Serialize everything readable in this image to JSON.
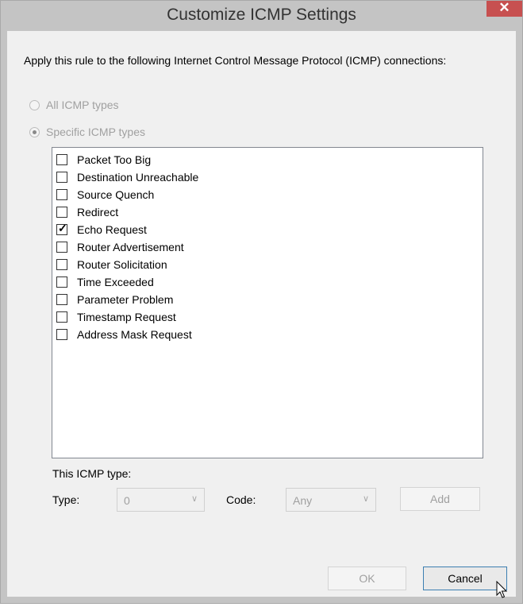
{
  "window": {
    "title": "Customize ICMP Settings",
    "close_glyph": "✕"
  },
  "intro_text": "Apply this rule to the following Internet Control Message Protocol (ICMP) connections:",
  "radios": [
    {
      "label": "All ICMP types",
      "selected": false
    },
    {
      "label": "Specific ICMP types",
      "selected": true
    }
  ],
  "icmp_types": [
    {
      "label": "Packet Too Big",
      "checked": false
    },
    {
      "label": "Destination Unreachable",
      "checked": false
    },
    {
      "label": "Source Quench",
      "checked": false
    },
    {
      "label": "Redirect",
      "checked": false
    },
    {
      "label": "Echo Request",
      "checked": true
    },
    {
      "label": "Router Advertisement",
      "checked": false
    },
    {
      "label": "Router Solicitation",
      "checked": false
    },
    {
      "label": "Time Exceeded",
      "checked": false
    },
    {
      "label": "Parameter Problem",
      "checked": false
    },
    {
      "label": "Timestamp Request",
      "checked": false
    },
    {
      "label": "Address Mask Request",
      "checked": false
    }
  ],
  "this_type": {
    "label": "This ICMP type:",
    "type_label": "Type:",
    "type_value": "0",
    "code_label": "Code:",
    "code_value": "Any",
    "add_label": "Add"
  },
  "buttons": {
    "ok": "OK",
    "cancel": "Cancel"
  },
  "icons": {
    "close": "close-icon",
    "chevron": "chevron-down-icon",
    "checkmark": "checkmark-icon",
    "cursor": "mouse-pointer-icon"
  },
  "colors": {
    "close_button": "#c75050",
    "dialog_body": "#f0f0f0",
    "title_bar": "#c4c4c4",
    "default_button_border": "#3c7fb1"
  }
}
